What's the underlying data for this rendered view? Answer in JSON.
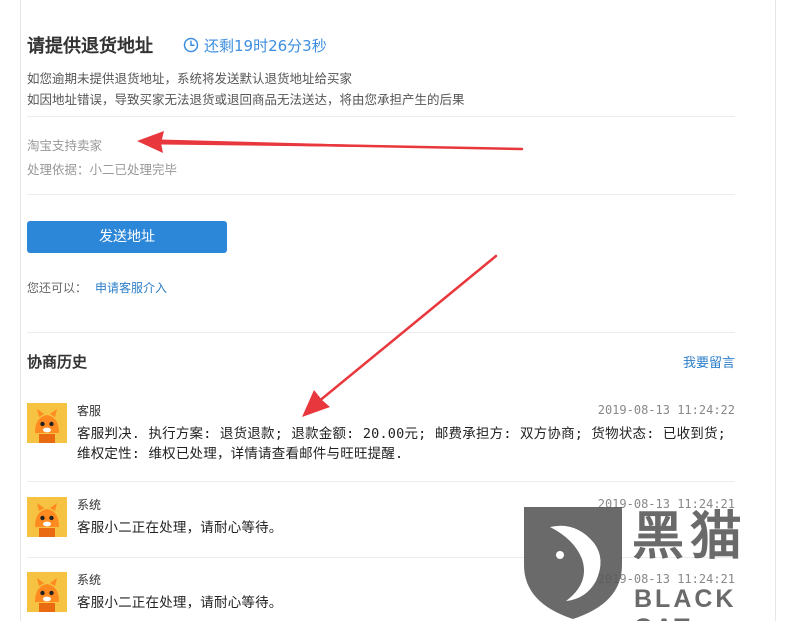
{
  "header": {
    "title": "请提供退货地址",
    "countdown": "还剩19时26分3秒"
  },
  "notice": {
    "line1": "如您逾期未提供退货地址，系统将发送默认退货地址给买家",
    "line2": "如因地址错误，导致买家无法退货或退回商品无法送达，将由您承担产生的后果"
  },
  "decision": {
    "support": "淘宝支持卖家",
    "basis": "处理依据：小二已处理完毕"
  },
  "actions": {
    "send_address": "发送地址",
    "alt_prefix": "您还可以：",
    "apply_cs": "申请客服介入"
  },
  "history": {
    "title": "协商历史",
    "leave_message": "我要留言",
    "records": [
      {
        "role": "客服",
        "time": "2019-08-13 11:24:22",
        "text": "客服判决. 执行方案: 退货退款; 退款金额: 20.00元; 邮费承担方: 双方协商; 货物状态: 已收到货; 维权定性: 维权已处理，详情请查看邮件与旺旺提醒."
      },
      {
        "role": "系统",
        "time": "2019-08-13 11:24:21",
        "text": "客服小二正在处理，请耐心等待。"
      },
      {
        "role": "系统",
        "time": "2019-08-13 11:24:21",
        "text": "客服小二正在处理，请耐心等待。"
      }
    ]
  },
  "watermark": {
    "cn": "黑猫",
    "en": "BLACK CAT"
  },
  "colors": {
    "accent": "#2d87d9",
    "link": "#2d7fc9",
    "countdown": "#3d8ee0",
    "annotation_arrow": "#e8383d",
    "avatar_bg": "#f5c242"
  },
  "icons": {
    "countdown": "clock-icon",
    "avatar": "mascot-avatar-icon"
  }
}
